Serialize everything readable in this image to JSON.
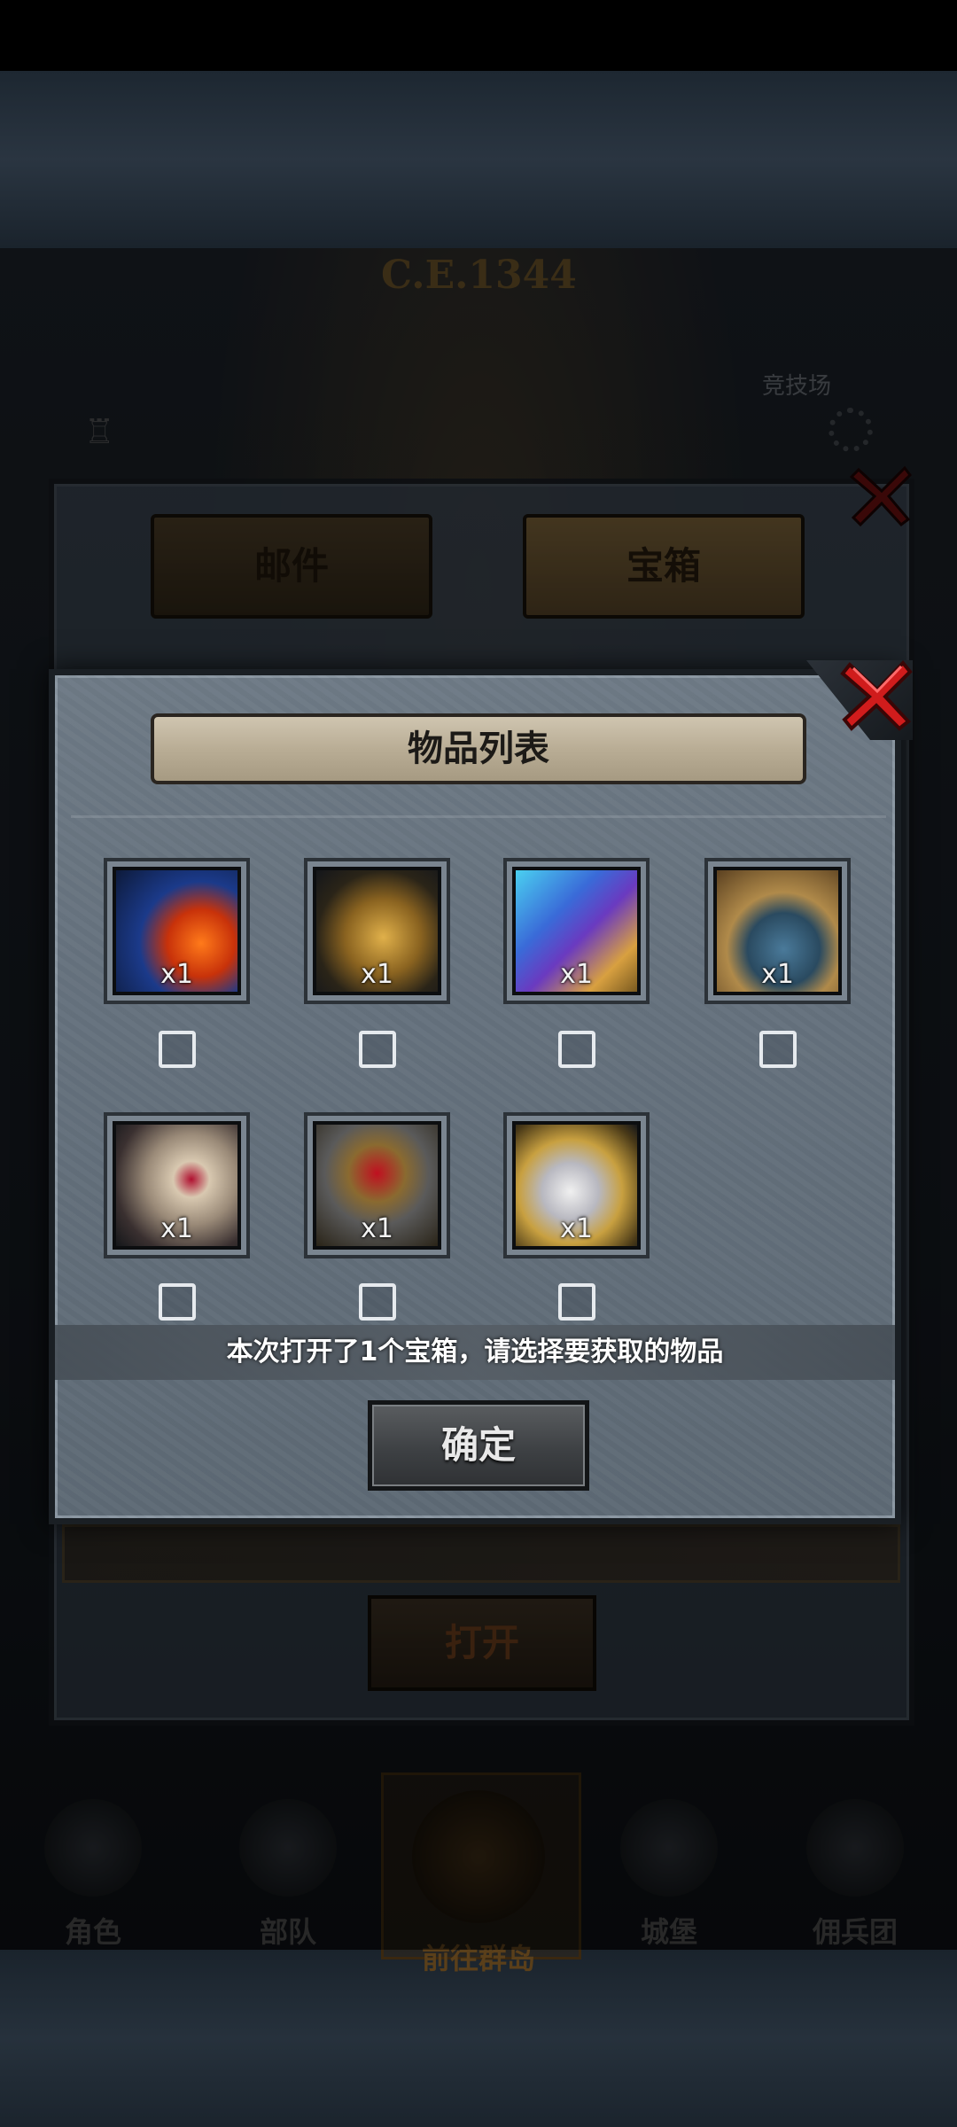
{
  "background": {
    "era_label": "C.E.1344",
    "arena_label": "竞技场"
  },
  "back_panel": {
    "tabs": [
      {
        "label": "邮件",
        "active": false
      },
      {
        "label": "宝箱",
        "active": true
      }
    ],
    "open_button": "打开"
  },
  "bottom_nav": [
    {
      "label": "角色"
    },
    {
      "label": "部队"
    },
    {
      "label": "前往群岛"
    },
    {
      "label": "城堡"
    },
    {
      "label": "佣兵团"
    }
  ],
  "dialog": {
    "title": "物品列表",
    "items": [
      {
        "icon": "fire-ice-artifact-icon",
        "qty": "x1",
        "checked": false
      },
      {
        "icon": "golden-shield-icon",
        "qty": "x1",
        "checked": false
      },
      {
        "icon": "spellbook-icon",
        "qty": "x1",
        "checked": false
      },
      {
        "icon": "winged-pauldron-icon",
        "qty": "x1",
        "checked": false
      },
      {
        "icon": "arcane-orb-shield-icon",
        "qty": "x1",
        "checked": false
      },
      {
        "icon": "skull-tome-icon",
        "qty": "x1",
        "checked": false
      },
      {
        "icon": "silver-gold-relic-icon",
        "qty": "x1",
        "checked": false
      }
    ],
    "hint": "本次打开了1个宝箱，请选择要获取的物品",
    "confirm_button": "确定"
  },
  "colors": {
    "dialog_bg": "#66727e",
    "close_red": "#c01818",
    "banner": "#b9ad95"
  }
}
